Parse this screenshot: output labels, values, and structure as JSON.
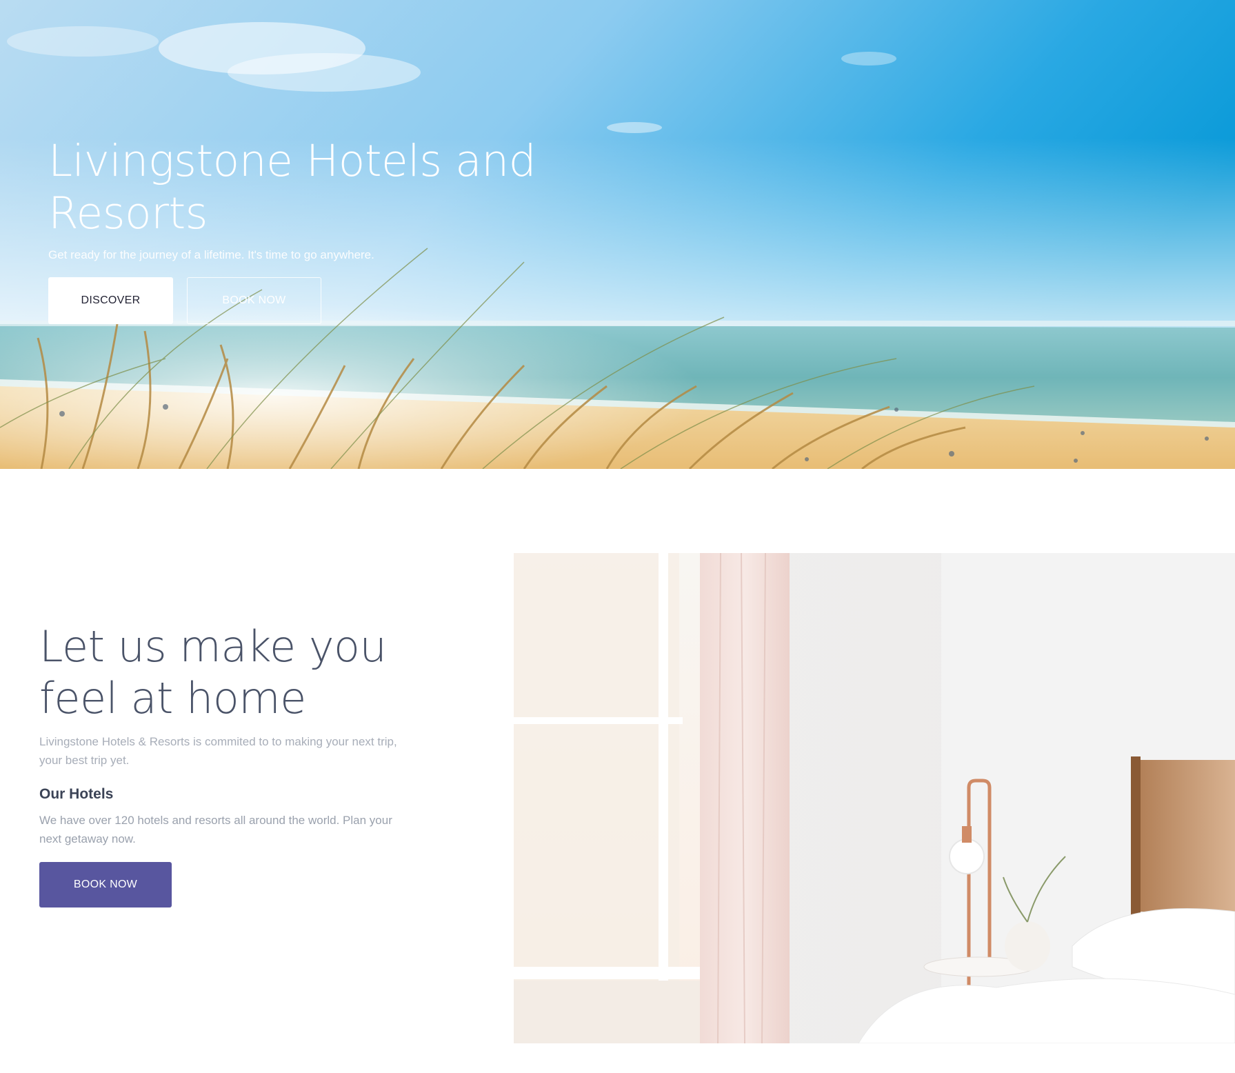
{
  "hero": {
    "title": "Livingstone Hotels and Resorts",
    "subtitle": "Get ready for the journey of a lifetime. It's time to go anywhere.",
    "discover_label": "DISCOVER",
    "book_label": "BOOK NOW"
  },
  "about": {
    "title": "Let us make you feel at home",
    "lead": "Livingstone Hotels & Resorts is commited to to making your next trip, your best trip yet.",
    "hotels_heading": "Our Hotels",
    "hotels_body": "We have over 120 hotels and resorts all around the world. Plan your next getaway now.",
    "book_label": "BOOK NOW"
  },
  "colors": {
    "primary_button": "#58569f",
    "heading_text": "#4a5368",
    "muted_text": "#a7adb8"
  }
}
